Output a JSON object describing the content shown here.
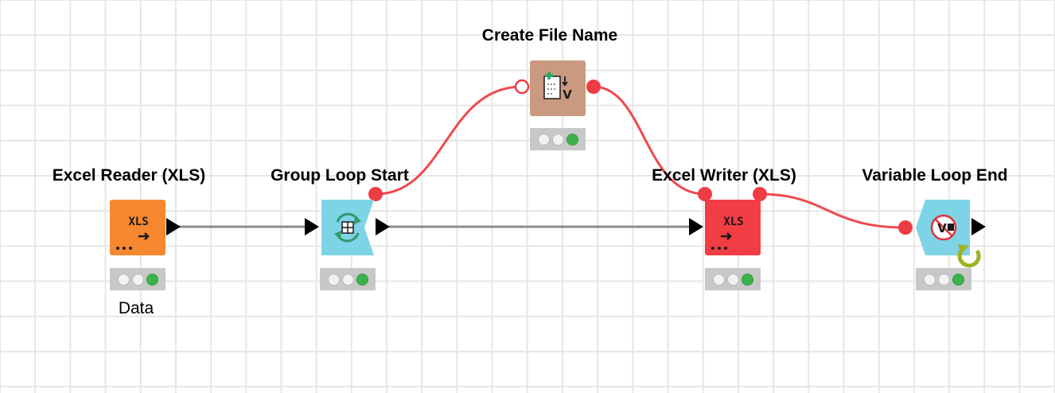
{
  "workflow": {
    "nodes": [
      {
        "id": "excel-reader",
        "label": "Excel Reader (XLS)",
        "sublabel": "Data",
        "icon": "excel-reader-icon",
        "color": "#f7882f",
        "status": "executed"
      },
      {
        "id": "group-loop-start",
        "label": "Group Loop Start",
        "icon": "loop-start-icon",
        "color": "#7fd3e6",
        "status": "executed"
      },
      {
        "id": "create-file-name",
        "label": "Create File Name",
        "icon": "variable-creator-icon",
        "color": "#c99a80",
        "status": "executed"
      },
      {
        "id": "excel-writer",
        "label": "Excel Writer (XLS)",
        "icon": "excel-writer-icon",
        "color": "#f23d45",
        "status": "executed"
      },
      {
        "id": "variable-loop-end",
        "label": "Variable Loop End",
        "icon": "loop-end-icon",
        "color": "#7fd3e6",
        "status": "executed"
      }
    ],
    "connections": [
      {
        "from": "excel-reader",
        "to": "group-loop-start",
        "kind": "data"
      },
      {
        "from": "group-loop-start",
        "to": "excel-writer",
        "kind": "data"
      },
      {
        "from": "group-loop-start",
        "to": "create-file-name",
        "kind": "flow-variable"
      },
      {
        "from": "create-file-name",
        "to": "excel-writer",
        "kind": "flow-variable"
      },
      {
        "from": "excel-writer",
        "to": "variable-loop-end",
        "kind": "flow-variable"
      }
    ],
    "icon_text": {
      "xls": "XLS",
      "variable": "V"
    },
    "colors": {
      "data_wire": "#8c8c8c",
      "flow_wire": "#ee4a50",
      "status_ok": "#3cb34a"
    }
  }
}
